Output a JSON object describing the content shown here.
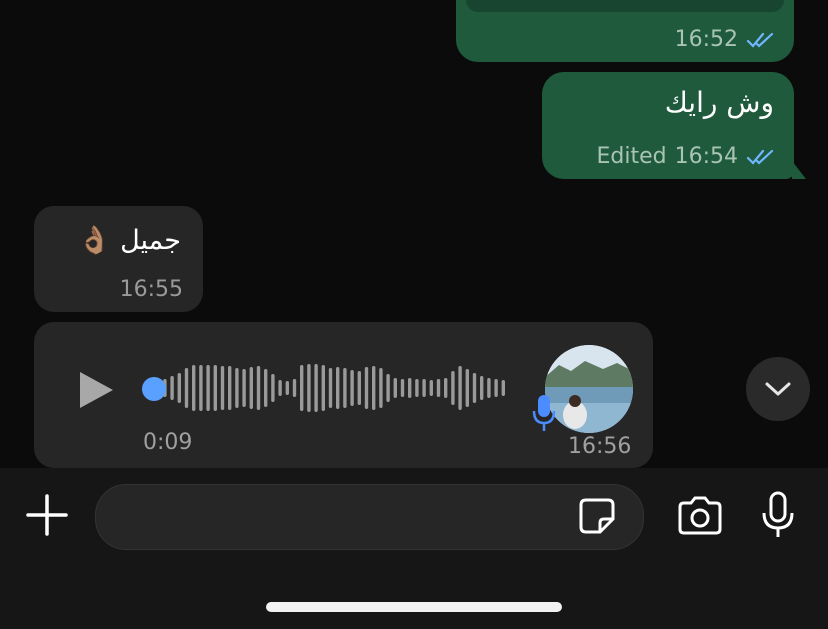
{
  "messages": {
    "outgoing_1": {
      "time": "16:52",
      "status": "read"
    },
    "outgoing_2": {
      "text": "وش رايك",
      "edited_label": "Edited",
      "time": "16:54",
      "status": "read"
    },
    "incoming_1": {
      "text": "جميل 👌🏽",
      "time": "16:55"
    },
    "voice_note": {
      "duration": "0:09",
      "time": "16:56",
      "playback_position": 0
    }
  },
  "composer": {
    "placeholder": "",
    "plus_icon": "plus-icon",
    "sticker_icon": "sticker-icon",
    "camera_icon": "camera-icon",
    "mic_icon": "microphone-icon"
  },
  "colors": {
    "outgoing_bubble": "#1f5a3d",
    "incoming_bubble": "#262626",
    "read_ticks": "#6fb7ff",
    "waveform": "#9a9a9a",
    "progress_dot": "#5aa0ff"
  }
}
